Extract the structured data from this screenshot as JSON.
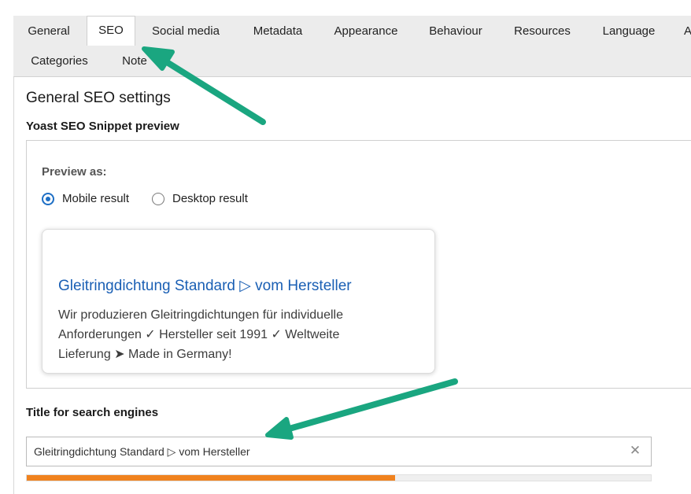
{
  "tabs": {
    "row1": [
      "General",
      "SEO",
      "Social media",
      "Metadata",
      "Appearance",
      "Behaviour",
      "Resources",
      "Language",
      "A"
    ],
    "row2": [
      "Categories",
      "Note"
    ],
    "active": "SEO"
  },
  "seo": {
    "heading": "General SEO settings",
    "snippet_heading": "Yoast SEO Snippet preview",
    "preview_as_label": "Preview as:",
    "mobile_label": "Mobile result",
    "desktop_label": "Desktop result",
    "selected_preview": "Mobile result",
    "snippet": {
      "title": "Gleitringdichtung Standard ▷ vom Hersteller",
      "description": "Wir produzieren Gleitringdichtungen für individuelle Anforderungen ✓ Hersteller seit 1991 ✓ Weltweite Lieferung ➤ Made in Germany!"
    },
    "title_field_label": "Title for search engines",
    "title_value": "Gleitringdichtung Standard ▷ vom Hersteller",
    "title_progress_percent": 59
  },
  "icons": {
    "clear": "close-icon",
    "annotation": "arrow-icon"
  },
  "colors": {
    "accent_blue": "#1e6fc5",
    "link_blue": "#1a5fb4",
    "progress_orange": "#f0821e",
    "arrow_green": "#1aa680"
  }
}
